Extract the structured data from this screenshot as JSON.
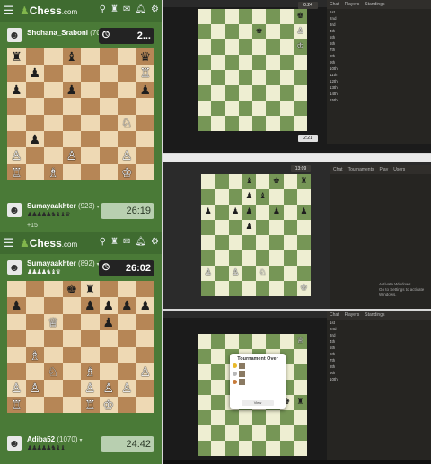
{
  "brand": {
    "logo_text": "Chess",
    "logo_domain": ".com"
  },
  "topbar_icons": [
    "puzzle-icon",
    "trophy-icon",
    "mail-icon",
    "bell-icon",
    "gear-icon"
  ],
  "game1": {
    "opponent": {
      "name": "Shohana_Sraboni",
      "rating": "(700)",
      "clock": "2..."
    },
    "player": {
      "name": "Sumayaakhter",
      "rating": "(923)",
      "clock": "26:19",
      "captured": "♟♟♟♟♟♞♝♝♛",
      "bonus": "+15"
    },
    "board": [
      [
        "♜b",
        "",
        "",
        "♝b",
        "",
        "",
        "",
        "♛b"
      ],
      [
        "",
        "♟b",
        "",
        "",
        "",
        "",
        "",
        "♖w"
      ],
      [
        "♟b",
        "",
        "",
        "♟b",
        "",
        "",
        "",
        "♟b"
      ],
      [
        "",
        "",
        "",
        "",
        "",
        "",
        "",
        ""
      ],
      [
        "",
        "",
        "",
        "",
        "",
        "",
        "♘w",
        ""
      ],
      [
        "",
        "♟b",
        "",
        "",
        "",
        "",
        "",
        ""
      ],
      [
        "♙w",
        "",
        "",
        "♙w",
        "",
        "",
        "♙w",
        ""
      ],
      [
        "♖w",
        "",
        "♗w",
        "",
        "",
        "",
        "♔w",
        ""
      ]
    ]
  },
  "game2": {
    "opponent": {
      "name": "Sumayaakhter",
      "rating": "(892)",
      "clock": "26:02",
      "captured": "♟♟♟♟♞♝♛"
    },
    "player": {
      "name": "Adiba52",
      "rating": "(1070)",
      "clock": "24:42",
      "captured": "♟♟♟♟♟♞♝♝"
    },
    "board": [
      [
        "",
        "",
        "",
        "♚b",
        "♜b",
        "",
        "",
        ""
      ],
      [
        "♟b",
        "",
        "",
        "",
        "♟b",
        "♟b",
        "♟b",
        "♟b"
      ],
      [
        "",
        "",
        "♕w",
        "",
        "",
        "♟b",
        "",
        ""
      ],
      [
        "",
        "",
        "",
        "",
        "",
        "",
        "",
        ""
      ],
      [
        "",
        "♗w",
        "",
        "",
        "",
        "",
        "",
        ""
      ],
      [
        "",
        "",
        "♘w",
        "",
        "♗w",
        "",
        "",
        "♙w"
      ],
      [
        "♙w",
        "♙w",
        "",
        "",
        "♙w",
        "♙w",
        "♙w",
        ""
      ],
      [
        "♖w",
        "",
        "",
        "",
        "♖w",
        "♔w",
        "",
        ""
      ]
    ]
  },
  "stream1": {
    "bottom_clock": "2:21",
    "top_clock": "0:24",
    "tabs": [
      "Chat",
      "Players",
      "Standings"
    ],
    "board": [
      [
        "",
        "",
        "",
        "",
        "",
        "",
        "",
        "♚b"
      ],
      [
        "",
        "",
        "",
        "",
        "♚b",
        "",
        "",
        "♙w"
      ],
      [
        "",
        "",
        "",
        "",
        "",
        "",
        "",
        "♔w"
      ],
      [
        "",
        "",
        "",
        "",
        "",
        "",
        "",
        ""
      ],
      [
        "",
        "",
        "",
        "",
        "",
        "",
        "",
        ""
      ],
      [
        "",
        "",
        "",
        "",
        "",
        "",
        "",
        ""
      ],
      [
        "",
        "",
        "",
        "",
        "",
        "",
        "",
        ""
      ],
      [
        "",
        "",
        "",
        "",
        "",
        "",
        "",
        ""
      ]
    ],
    "rows": [
      "1st",
      "2nd",
      "3rd",
      "4th",
      "5th",
      "6th",
      "7th",
      "8th",
      "9th",
      "10th",
      "11th",
      "12th",
      "13th",
      "14th",
      "15th"
    ]
  },
  "stream2": {
    "top_clock": "13:09",
    "tabs": [
      "Chat",
      "Tournaments",
      "Play",
      "Users"
    ],
    "board": [
      [
        "",
        "",
        "",
        "♝b",
        "",
        "♚b",
        "",
        "♜b"
      ],
      [
        "",
        "",
        "",
        "♟b",
        "♝b",
        "",
        "",
        ""
      ],
      [
        "♟b",
        "",
        "♟b",
        "♟b",
        "",
        "♟b",
        "",
        "♟b"
      ],
      [
        "",
        "",
        "",
        "♟b",
        "",
        "",
        "",
        ""
      ],
      [
        "",
        "",
        "",
        "",
        "",
        "",
        "",
        ""
      ],
      [
        "",
        "",
        "",
        "",
        "",
        "",
        "",
        ""
      ],
      [
        "♙w",
        "",
        "♙w",
        "",
        "♘w",
        "",
        "",
        ""
      ],
      [
        "",
        "",
        "",
        "",
        "",
        "",
        "",
        "♔w"
      ]
    ],
    "toast_title": "Activate Windows",
    "toast_body": "Go to Settings to activate Windows."
  },
  "stream3": {
    "modal_title": "Tournament Over",
    "modal_button": "View",
    "board": [
      [
        "",
        "",
        "",
        "",
        "",
        "",
        "",
        "♕w"
      ],
      [
        "",
        "",
        "",
        "",
        "",
        "",
        "",
        ""
      ],
      [
        "",
        "",
        "",
        "",
        "",
        "",
        "",
        ""
      ],
      [
        "",
        "",
        "",
        "",
        "",
        "",
        "",
        ""
      ],
      [
        "",
        "",
        "",
        "",
        "",
        "",
        "♚b",
        "♜b"
      ],
      [
        "",
        "",
        "",
        "",
        "",
        "",
        "",
        ""
      ],
      [
        "",
        "",
        "",
        "",
        "",
        "",
        "",
        ""
      ],
      [
        "",
        "",
        "",
        "",
        "",
        "",
        "",
        ""
      ]
    ]
  }
}
